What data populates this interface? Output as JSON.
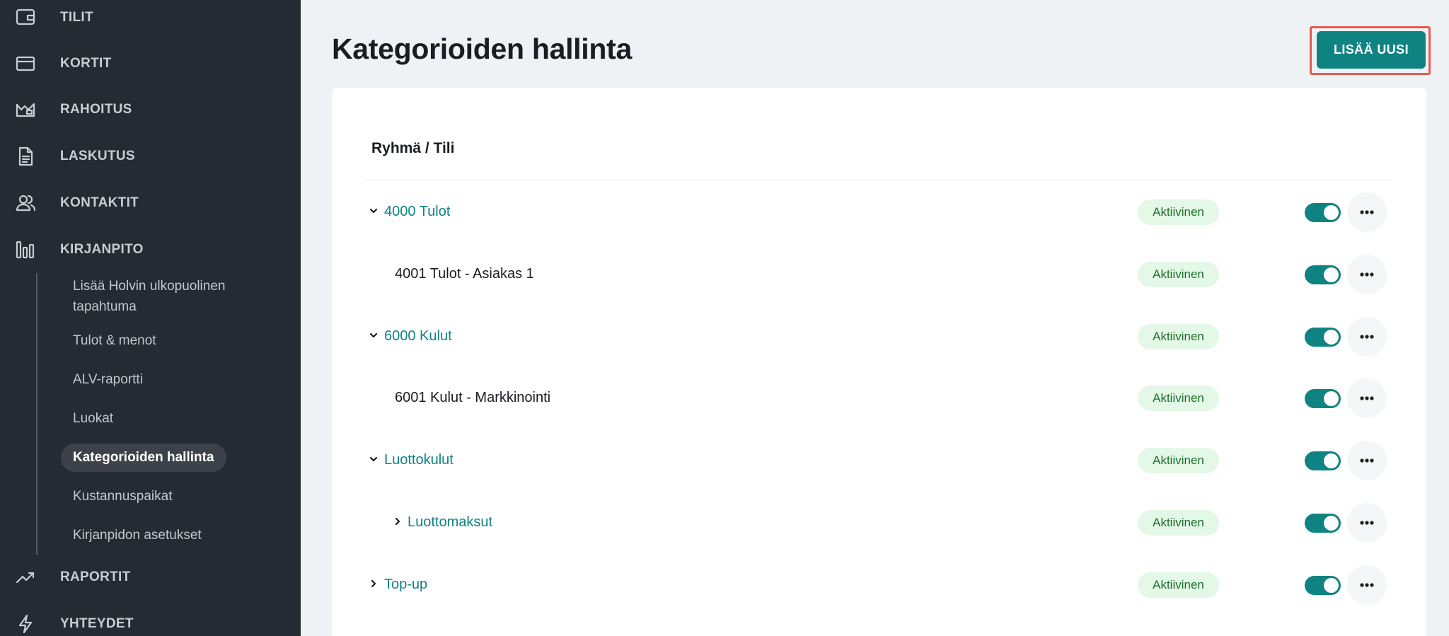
{
  "sidebar": {
    "nav": [
      {
        "label": "TILIT",
        "icon": "wallet-icon"
      },
      {
        "label": "KORTIT",
        "icon": "card-icon"
      },
      {
        "label": "RAHOITUS",
        "icon": "financing-icon"
      },
      {
        "label": "LASKUTUS",
        "icon": "document-icon"
      },
      {
        "label": "KONTAKTIT",
        "icon": "contacts-icon"
      },
      {
        "label": "KIRJANPITO",
        "icon": "bar-chart-icon"
      },
      {
        "label": "RAPORTIT",
        "icon": "trend-icon"
      },
      {
        "label": "YHTEYDET",
        "icon": "lightning-icon"
      }
    ],
    "subnav": [
      {
        "label": "Lisää Holvin ulkopuolinen tapahtuma"
      },
      {
        "label": "Tulot & menot"
      },
      {
        "label": "ALV-raportti"
      },
      {
        "label": "Luokat"
      },
      {
        "label": "Kategorioiden hallinta",
        "active": true
      },
      {
        "label": "Kustannuspaikat"
      },
      {
        "label": "Kirjanpidon asetukset"
      }
    ]
  },
  "main": {
    "title": "Kategorioiden hallinta",
    "add_button": "LISÄÄ UUSI",
    "column_header": "Ryhmä / Tili",
    "rows": [
      {
        "name": "4000 Tulot",
        "status": "Aktiivinen",
        "level": 0,
        "expand": "expanded",
        "link": true,
        "enabled": true
      },
      {
        "name": "4001 Tulot - Asiakas 1",
        "status": "Aktiivinen",
        "level": 1,
        "expand": "none",
        "link": false,
        "enabled": true
      },
      {
        "name": "6000 Kulut",
        "status": "Aktiivinen",
        "level": 0,
        "expand": "expanded",
        "link": true,
        "enabled": true
      },
      {
        "name": "6001 Kulut - Markkinointi",
        "status": "Aktiivinen",
        "level": 1,
        "expand": "none",
        "link": false,
        "enabled": true
      },
      {
        "name": "Luottokulut",
        "status": "Aktiivinen",
        "level": 0,
        "expand": "expanded",
        "link": true,
        "enabled": true
      },
      {
        "name": "Luottomaksut",
        "status": "Aktiivinen",
        "level": 1,
        "expand": "collapsed",
        "link": true,
        "enabled": true
      },
      {
        "name": "Top-up",
        "status": "Aktiivinen",
        "level": 0,
        "expand": "collapsed",
        "link": true,
        "enabled": true
      }
    ]
  },
  "colors": {
    "sidebar_bg": "#262a33",
    "accent": "#0f8382",
    "badge_bg": "#e3f8e6",
    "badge_text": "#1e6e2c",
    "highlight_outline": "#e85a4f"
  }
}
